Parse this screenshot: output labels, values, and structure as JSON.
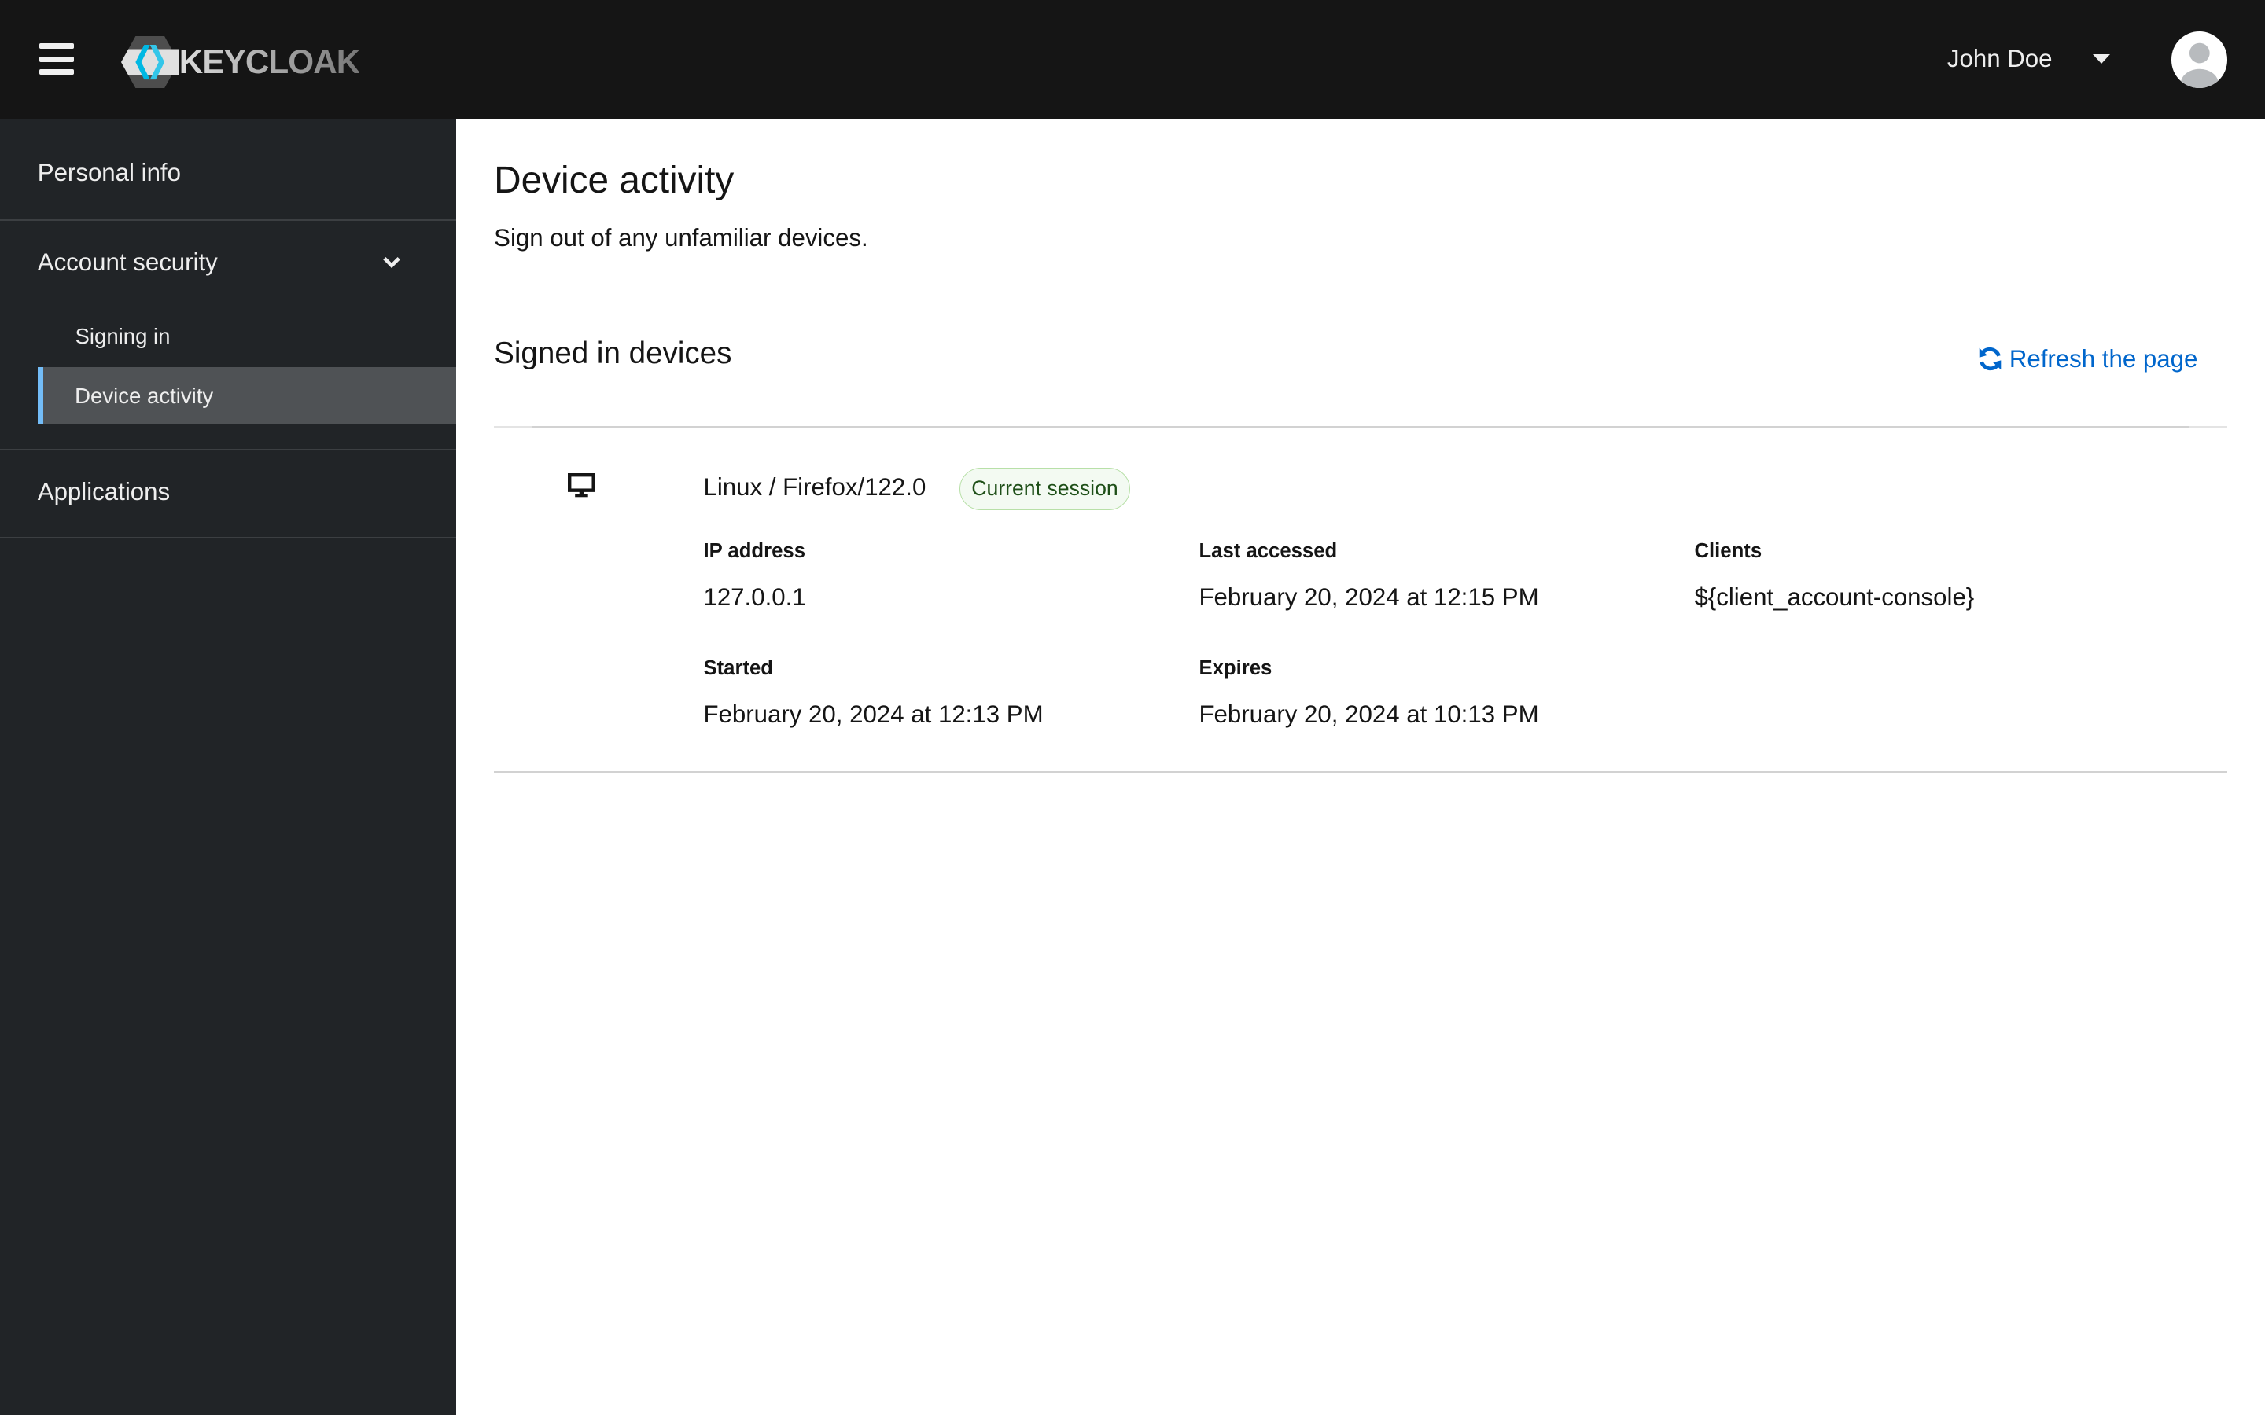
{
  "header": {
    "logo": "KEYCLOAK",
    "user_name": "John Doe"
  },
  "sidebar": {
    "items": [
      {
        "label": "Personal info"
      },
      {
        "label": "Account security",
        "children": [
          {
            "label": "Signing in"
          },
          {
            "label": "Device activity",
            "active": true
          }
        ]
      },
      {
        "label": "Applications"
      }
    ]
  },
  "main": {
    "title": "Device activity",
    "subtitle": "Sign out of any unfamiliar devices.",
    "section_title": "Signed in devices",
    "refresh_label": "Refresh the page",
    "device": {
      "name": "Linux / Firefox/122.0",
      "badge": "Current session",
      "ip_label": "IP address",
      "ip": "127.0.0.1",
      "last_accessed_label": "Last accessed",
      "last_accessed": "February 20, 2024 at 12:15 PM",
      "clients_label": "Clients",
      "clients": "${client_account-console}",
      "started_label": "Started",
      "started": "February 20, 2024 at 12:13 PM",
      "expires_label": "Expires",
      "expires": "February 20, 2024 at 10:13 PM"
    }
  },
  "colors": {
    "accent": "#0066cc",
    "header_bg": "#151515",
    "sidebar_bg": "#212427",
    "active_border": "#73bcf7"
  }
}
